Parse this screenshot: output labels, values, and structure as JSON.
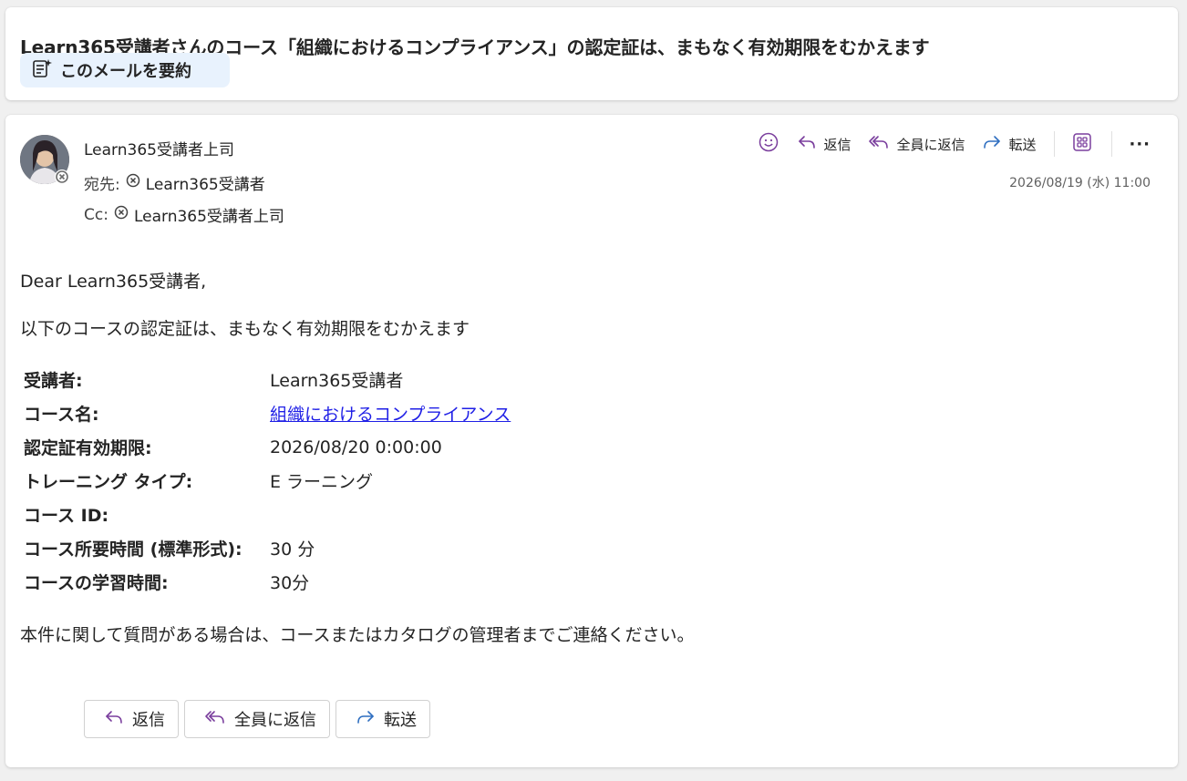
{
  "subject": "Learn365受講者さんのコース「組織におけるコンプライアンス」の認定証は、まもなく有効期限をむかえます",
  "summarize_label": "このメールを要約",
  "sender": {
    "name": "Learn365受講者上司",
    "to_label": "宛先:",
    "to": "Learn365受講者",
    "cc_label": "Cc:",
    "cc": "Learn365受講者上司",
    "timestamp": "2026/08/19 (水) 11:00"
  },
  "toolbar": {
    "emoji_icon": "emoji-icon",
    "reply": "返信",
    "reply_all": "全員に返信",
    "forward": "転送",
    "apps_icon": "apps-icon",
    "more": "···"
  },
  "body": {
    "greeting": "Dear Learn365受講者,",
    "intro": "以下のコースの認定証は、まもなく有効期限をむかえます",
    "details": [
      {
        "label": "受講者:",
        "value": "Learn365受講者",
        "link": false
      },
      {
        "label": "コース名:",
        "value": "組織におけるコンプライアンス",
        "link": true
      },
      {
        "label": "認定証有効期限:",
        "value": "2026/08/20 0:00:00",
        "link": false
      },
      {
        "label": "トレーニング タイプ:",
        "value": "E ラーニング",
        "link": false
      },
      {
        "label": "コース ID:",
        "value": "",
        "link": false
      },
      {
        "label": "コース所要時間 (標準形式):",
        "value": "30 分",
        "link": false
      },
      {
        "label": "コースの学習時間:",
        "value": "30分",
        "link": false
      }
    ],
    "footer": "本件に関して質問がある場合は、コースまたはカタログの管理者までご連絡ください。"
  },
  "bottom_buttons": {
    "reply": "返信",
    "reply_all": "全員に返信",
    "forward": "転送"
  },
  "colors": {
    "accent_purple": "#7a3e9d",
    "forward_blue": "#2f6fc0",
    "link": "#1f1fe6",
    "summarize_bg": "#e8f2fd"
  }
}
